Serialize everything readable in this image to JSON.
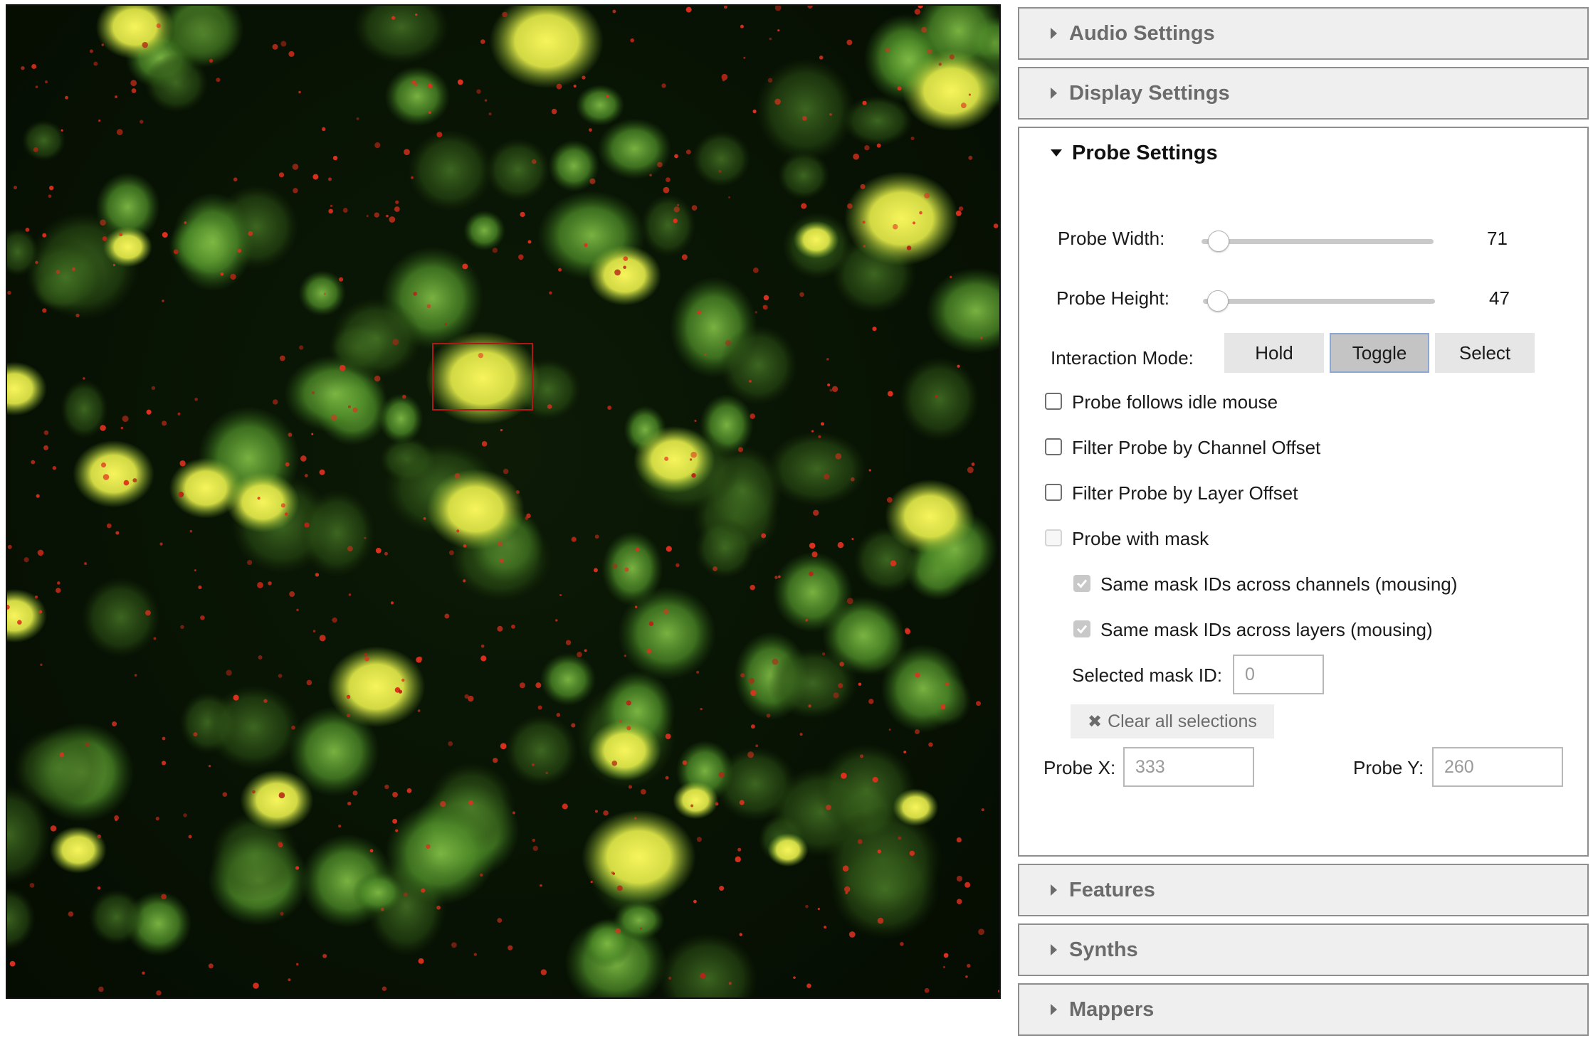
{
  "colors": {
    "background": "#081304",
    "cell_green": "#6fae3a",
    "cell_yellow": "#f4f25a",
    "speck_red": "#e0301e",
    "probe_box": "#b01818",
    "panel_header": "#efefef"
  },
  "viewer": {
    "image_name": "fluorescence-microscopy-image"
  },
  "sections": {
    "audio": "Audio Settings",
    "display": "Display Settings",
    "probe": "Probe Settings",
    "features": "Features",
    "synths": "Synths",
    "mappers": "Mappers"
  },
  "probe": {
    "width_label": "Probe Width:",
    "width_value": "71",
    "width_fraction": 0.03,
    "height_label": "Probe Height:",
    "height_value": "47",
    "height_fraction": 0.02,
    "mode_label": "Interaction Mode:",
    "modes": [
      "Hold",
      "Toggle",
      "Select"
    ],
    "active_mode": "Toggle",
    "options": {
      "idle_mouse": "Probe follows idle mouse",
      "channel_offset": "Filter Probe by Channel Offset",
      "layer_offset": "Filter Probe by Layer Offset",
      "with_mask": "Probe with mask",
      "same_mask_channels": "Same mask IDs across channels (mousing)",
      "same_mask_layers": "Same mask IDs across layers (mousing)"
    },
    "selected_mask_label": "Selected mask ID:",
    "selected_mask_placeholder": "0",
    "clear_label": "Clear all selections",
    "x_label": "Probe X:",
    "x_placeholder": "333",
    "y_label": "Probe Y:",
    "y_placeholder": "260"
  }
}
